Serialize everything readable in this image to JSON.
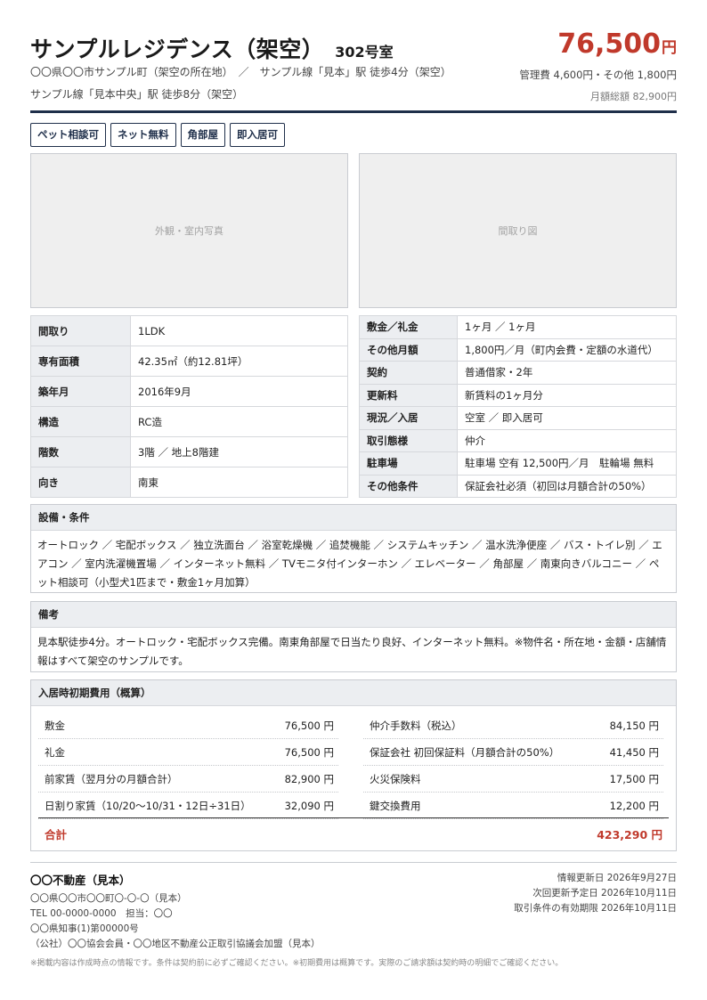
{
  "header": {
    "title": "サンプルレジデンス（架空）",
    "room": "302号室",
    "address_line1": "〇〇県〇〇市サンプル町（架空の所在地）　／　サンプル線「見本」駅 徒歩4分（架空）",
    "address_line2": "サンプル線「見本中央」駅 徒歩8分（架空）",
    "rent_amount": "76,500",
    "rent_unit": "円",
    "fees": "管理費 4,600円・その他 1,800円",
    "monthly_total": "月額総額 82,900円"
  },
  "tags": [
    "ペット相談可",
    "ネット無料",
    "角部屋",
    "即入居可"
  ],
  "photos": {
    "exterior": "外観・室内写真",
    "floorplan": "間取り図"
  },
  "spec_left": [
    {
      "label": "間取り",
      "value": "1LDK"
    },
    {
      "label": "専有面積",
      "value": "42.35㎡（約12.81坪）"
    },
    {
      "label": "築年月",
      "value": "2016年9月"
    },
    {
      "label": "構造",
      "value": "RC造"
    },
    {
      "label": "階数",
      "value": "3階 ／ 地上8階建"
    },
    {
      "label": "向き",
      "value": "南東"
    }
  ],
  "spec_right": [
    {
      "label": "敷金／礼金",
      "value": "1ヶ月 ／ 1ヶ月"
    },
    {
      "label": "その他月額",
      "value": "1,800円／月（町内会費・定額の水道代）"
    },
    {
      "label": "契約",
      "value": "普通借家・2年"
    },
    {
      "label": "更新料",
      "value": "新賃料の1ヶ月分"
    },
    {
      "label": "現況／入居",
      "value": "空室 ／ 即入居可"
    },
    {
      "label": "取引態様",
      "value": "仲介"
    },
    {
      "label": "駐車場",
      "value": "駐車場 空有 12,500円／月　駐輪場 無料"
    },
    {
      "label": "その他条件",
      "value": "保証会社必須（初回は月額合計の50%）"
    }
  ],
  "equipment": {
    "heading": "設備・条件",
    "body": "オートロック ／ 宅配ボックス ／ 独立洗面台 ／ 浴室乾燥機 ／ 追焚機能 ／ システムキッチン ／ 温水洗浄便座 ／ バス・トイレ別 ／ エアコン ／ 室内洗濯機置場 ／ インターネット無料 ／ TVモニタ付インターホン ／ エレベーター ／ 角部屋 ／ 南東向きバルコニー ／ ペット相談可（小型犬1匹まで・敷金1ヶ月加算）"
  },
  "notes": {
    "heading": "備考",
    "body": "見本駅徒歩4分。オートロック・宅配ボックス完備。南東角部屋で日当たり良好、インターネット無料。※物件名・所在地・金額・店舗情報はすべて架空のサンプルです。"
  },
  "costs": {
    "heading": "入居時初期費用（概算）",
    "left": [
      {
        "label": "敷金",
        "value": "76,500 円"
      },
      {
        "label": "礼金",
        "value": "76,500 円"
      },
      {
        "label": "前家賃（翌月分の月額合計）",
        "value": "82,900 円"
      },
      {
        "label": "日割り家賃（10/20〜10/31・12日÷31日）",
        "value": "32,090 円"
      }
    ],
    "right": [
      {
        "label": "仲介手数料（税込）",
        "value": "84,150 円"
      },
      {
        "label": "保証会社 初回保証料（月額合計の50%）",
        "value": "41,450 円"
      },
      {
        "label": "火災保険料",
        "value": "17,500 円"
      },
      {
        "label": "鍵交換費用",
        "value": "12,200 円"
      }
    ],
    "total_label": "合計",
    "total_value": "423,290 円"
  },
  "footer": {
    "agent_name": "〇〇不動産（見本）",
    "agent_lines": [
      "〇〇県〇〇市〇〇町〇-〇-〇（見本）",
      "TEL 00-0000-0000　担当：〇〇",
      "〇〇県知事(1)第00000号",
      "（公社）〇〇協会会員・〇〇地区不動産公正取引協議会加盟（見本）"
    ],
    "dates": [
      "情報更新日 2026年9月27日",
      "次回更新予定日 2026年10月11日",
      "取引条件の有効期限 2026年10月11日"
    ],
    "disclaimer": "※掲載内容は作成時点の情報です。条件は契約前に必ずご確認ください。※初期費用は概算です。実際のご請求額は契約時の明細でご確認ください。"
  }
}
